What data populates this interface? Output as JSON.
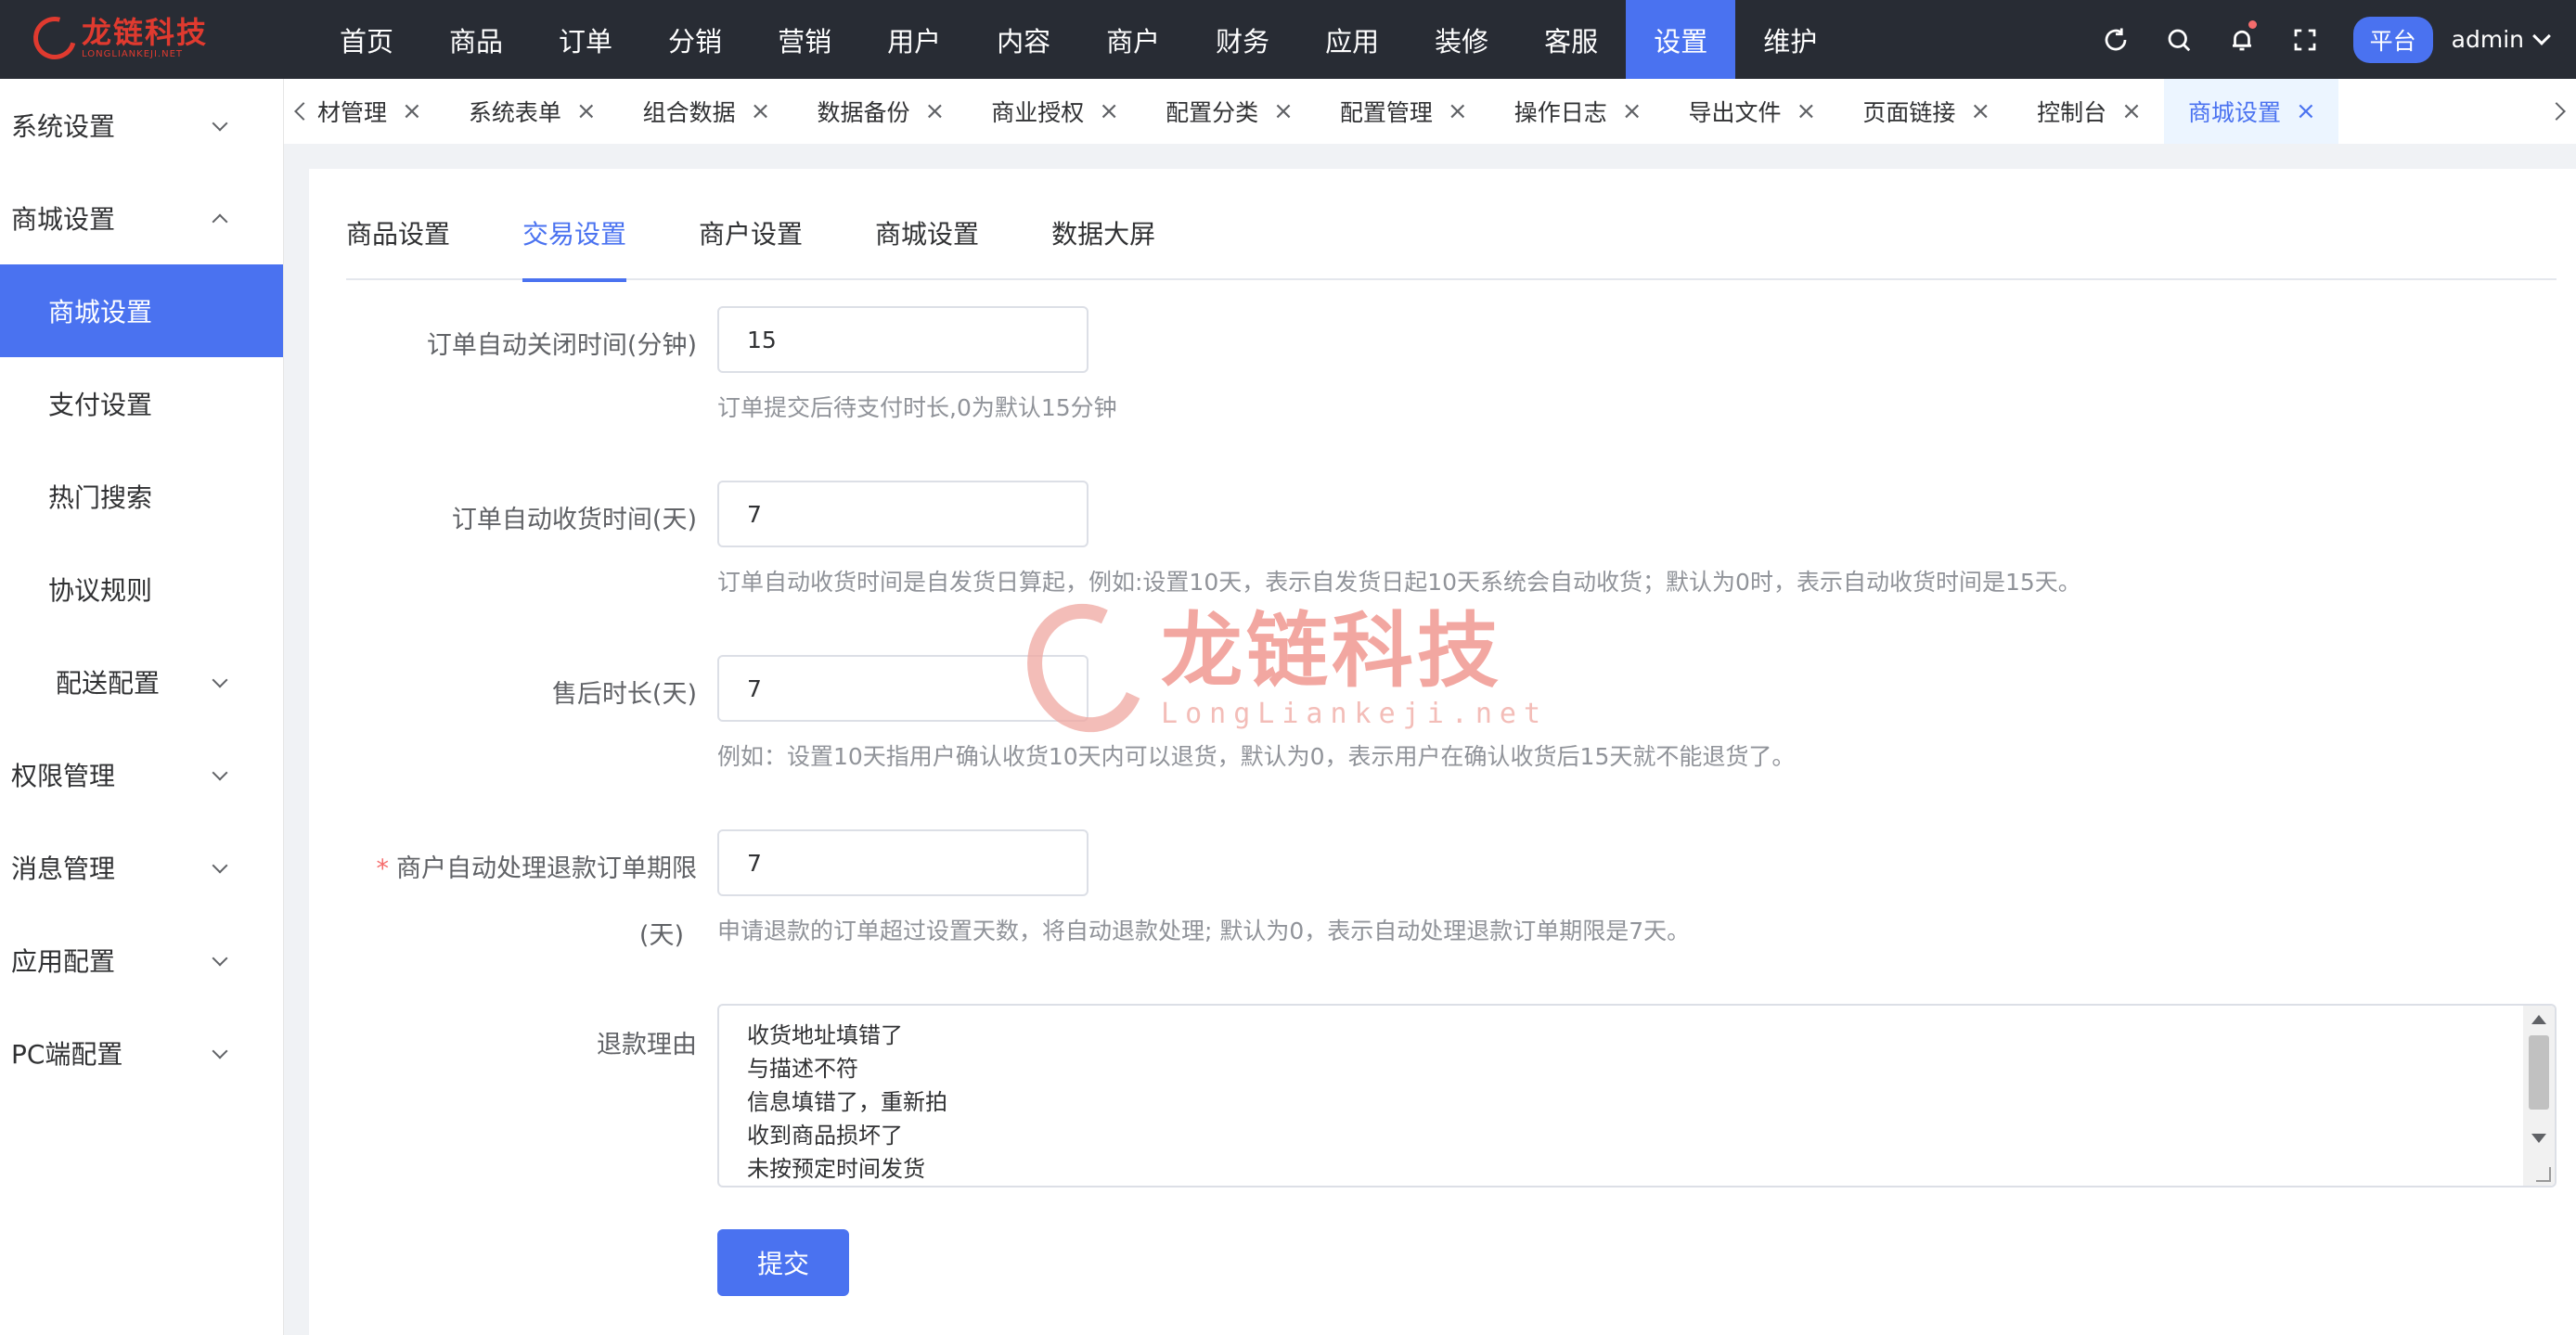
{
  "logo": {
    "title": "龙链科技",
    "subtitle": "LONGLIANKEJI.NET"
  },
  "topnav": {
    "items": [
      "首页",
      "商品",
      "订单",
      "分销",
      "营销",
      "用户",
      "内容",
      "商户",
      "财务",
      "应用",
      "装修",
      "客服",
      "设置",
      "维护"
    ],
    "active": "设置",
    "platform_label": "平台",
    "user": "admin"
  },
  "sidebar": {
    "items": [
      {
        "label": "系统设置"
      },
      {
        "label": "商城设置"
      },
      {
        "label": "商城设置"
      },
      {
        "label": "支付设置"
      },
      {
        "label": "热门搜索"
      },
      {
        "label": "协议规则"
      },
      {
        "label": "配送配置"
      },
      {
        "label": "权限管理"
      },
      {
        "label": "消息管理"
      },
      {
        "label": "应用配置"
      },
      {
        "label": "PC端配置"
      }
    ]
  },
  "tabs": {
    "items": [
      "材管理",
      "系统表单",
      "组合数据",
      "数据备份",
      "商业授权",
      "配置分类",
      "配置管理",
      "操作日志",
      "导出文件",
      "页面链接",
      "控制台",
      "商城设置"
    ],
    "close_glyph": "×"
  },
  "subtabs": [
    "商品设置",
    "交易设置",
    "商户设置",
    "商城设置",
    "数据大屏"
  ],
  "form": {
    "close_time": {
      "label": "订单自动关闭时间(分钟)",
      "value": "15",
      "hint": "订单提交后待支付时长,0为默认15分钟"
    },
    "receive_time": {
      "label": "订单自动收货时间(天)",
      "value": "7",
      "hint": "订单自动收货时间是自发货日算起，例如:设置10天，表示自发货日起10天系统会自动收货；默认为0时，表示自动收货时间是15天。"
    },
    "after_sale": {
      "label": "售后时长(天)",
      "value": "7",
      "hint": "例如：设置10天指用户确认收货10天内可以退货，默认为0，表示用户在确认收货后15天就不能退货了。"
    },
    "refund_limit": {
      "required_mark": "*",
      "label_line1": "商户自动处理退款订单期限",
      "label_line2": "(天)",
      "value": "7",
      "hint": "申请退款的订单超过设置天数，将自动退款处理; 默认为0，表示自动处理退款订单期限是7天。"
    },
    "refund_reason": {
      "label": "退款理由",
      "lines": [
        "收货地址填错了",
        "与描述不符",
        "信息填错了，重新拍",
        "收到商品损坏了",
        "未按预定时间发货"
      ]
    },
    "submit_label": "提交"
  },
  "watermark": {
    "title": "龙链科技",
    "subtitle": "LongLiankeji.net"
  }
}
